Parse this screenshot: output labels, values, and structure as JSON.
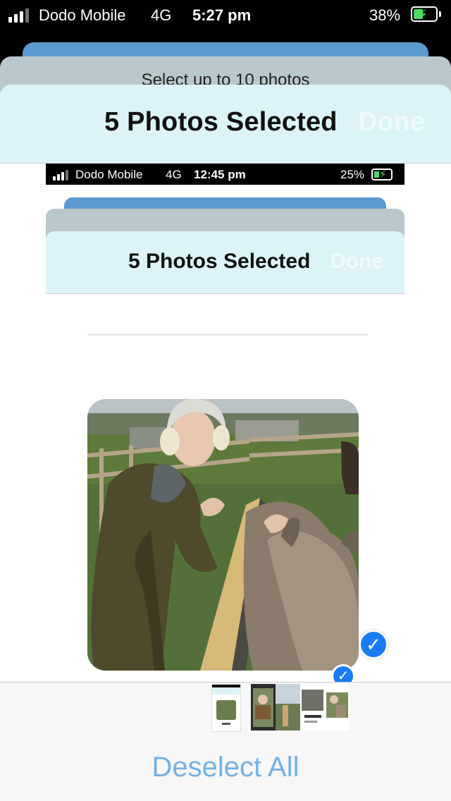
{
  "status_bar": {
    "carrier": "Dodo Mobile",
    "network": "4G",
    "time": "5:27 pm",
    "battery": "38%"
  },
  "background_sheet": {
    "subtitle": "Select up to 10 photos"
  },
  "header": {
    "title": "5 Photos Selected",
    "done_label": "Done"
  },
  "preview": {
    "status_bar": {
      "carrier": "Dodo Mobile",
      "network": "4G",
      "time": "12:45 pm",
      "battery": "25%"
    },
    "header": {
      "title": "5 Photos Selected",
      "done_label": "Done"
    }
  },
  "selection": {
    "checkmark": "✓"
  },
  "bottom_bar": {
    "deselect_label": "Deselect All"
  },
  "colors": {
    "accent": "#1a7cf5",
    "deselect": "#73b2e3",
    "header_bg": "#dcf4f8"
  }
}
